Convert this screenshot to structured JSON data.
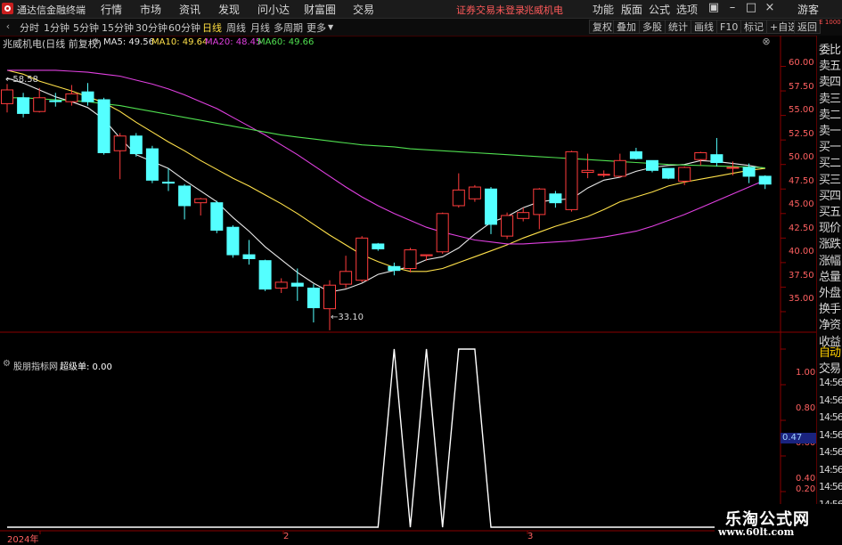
{
  "app": {
    "title": "通达信金融终端",
    "menu": [
      "行情",
      "市场",
      "资讯",
      "发现",
      "问小达",
      "财富圈",
      "交易"
    ],
    "warning": "证券交易未登录",
    "stock_name": "兆威机电",
    "right_menu": [
      "功能",
      "版面",
      "公式",
      "选项"
    ],
    "guest": "游客"
  },
  "toolbar": {
    "periods": [
      "分时",
      "1分钟",
      "5分钟",
      "15分钟",
      "30分钟",
      "60分钟",
      "日线",
      "周线",
      "月线",
      "多周期",
      "更多"
    ],
    "active_period": "日线",
    "buttons": [
      "复权",
      "叠加",
      "多股",
      "统计",
      "画线",
      "F10",
      "标记",
      "+自选",
      "返回"
    ]
  },
  "main_chart": {
    "header": "兆威机电(日线 前复权)",
    "ma": [
      {
        "label": "MA5: 49.56",
        "color": "#e8e8e8"
      },
      {
        "label": "MA10: 49.64",
        "color": "#ffe14a"
      },
      {
        "label": "MA20: 48.45",
        "color": "#e040e0"
      },
      {
        "label": "MA60: 49.66",
        "color": "#50e050"
      }
    ],
    "high_label": "58.58",
    "low_label": "33.10",
    "y_ticks": [
      "60.00",
      "57.50",
      "55.00",
      "52.50",
      "50.00",
      "47.50",
      "45.00",
      "42.50",
      "40.00",
      "37.50",
      "35.00"
    ]
  },
  "sub_chart": {
    "name": "股朋指标网",
    "series_label": "超级单: 0.00",
    "y_ticks": [
      "1.00",
      "0.80",
      "0.60",
      "0.40",
      "0.20"
    ],
    "cursor_value": "0.47"
  },
  "dates": [
    "2024年",
    "2",
    "3"
  ],
  "right_panel": {
    "header": "E 1000",
    "items": [
      "委比",
      "卖五",
      "卖四",
      "卖三",
      "卖二",
      "卖一",
      "买一",
      "买二",
      "买三",
      "买四",
      "买五",
      "现价",
      "涨跌",
      "涨幅",
      "总量",
      "外盘",
      "换手",
      "净资",
      "收益"
    ],
    "bottom_items": [
      "自动",
      "交易"
    ],
    "times": [
      "14:56",
      "14:56",
      "14:56",
      "14:56",
      "14:56",
      "14:56",
      "14:56",
      "14:56",
      "14:56"
    ]
  },
  "watermark": {
    "title": "乐淘公式网",
    "url": "www.60lt.com"
  },
  "chart_data": [
    {
      "type": "candlestick",
      "title": "兆威机电(日线 前复权)",
      "ylim": [
        33.0,
        61.5
      ],
      "up_color": "#ff3c3c",
      "down_color": "#54ffff",
      "candles": [
        [
          56.2,
          57.6,
          55.3,
          58.2
        ],
        [
          56.8,
          55.2,
          54.8,
          57.3
        ],
        [
          55.4,
          56.8,
          55.3,
          57.8
        ],
        [
          56.5,
          56.4,
          55.9,
          57.3
        ],
        [
          56.4,
          57.2,
          56.0,
          58.1
        ],
        [
          57.4,
          56.4,
          56.0,
          58.3
        ],
        [
          56.6,
          51.2,
          51.0,
          56.8
        ],
        [
          51.4,
          52.9,
          48.5,
          53.2
        ],
        [
          52.9,
          51.1,
          50.8,
          53.2
        ],
        [
          51.6,
          48.4,
          48.1,
          51.9
        ],
        [
          48.2,
          48.1,
          47.3,
          49.6
        ],
        [
          47.8,
          45.8,
          44.4,
          48.0
        ],
        [
          46.1,
          46.5,
          44.8,
          46.6
        ],
        [
          46.1,
          43.3,
          43.0,
          46.3
        ],
        [
          43.6,
          40.8,
          40.5,
          43.8
        ],
        [
          40.8,
          40.4,
          39.8,
          42.3
        ],
        [
          40.2,
          37.3,
          37.1,
          40.3
        ],
        [
          37.4,
          38.0,
          36.9,
          38.4
        ],
        [
          37.9,
          37.6,
          36.1,
          39.4
        ],
        [
          37.4,
          35.4,
          33.9,
          37.8
        ],
        [
          35.3,
          37.7,
          33.1,
          38.2
        ],
        [
          37.8,
          39.1,
          37.4,
          40.7
        ],
        [
          38.2,
          42.5,
          38.0,
          42.7
        ],
        [
          41.9,
          41.4,
          41.2,
          42.0
        ],
        [
          39.6,
          39.2,
          38.7,
          40.0
        ],
        [
          39.4,
          41.3,
          39.0,
          41.5
        ],
        [
          40.7,
          40.8,
          40.2,
          40.8
        ],
        [
          41.1,
          45.0,
          40.9,
          45.1
        ],
        [
          45.8,
          47.4,
          45.6,
          49.1
        ],
        [
          46.5,
          47.7,
          46.2,
          47.9
        ],
        [
          47.5,
          43.9,
          42.9,
          47.7
        ],
        [
          42.7,
          44.8,
          42.4,
          45.1
        ],
        [
          44.5,
          45.1,
          44.2,
          45.6
        ],
        [
          44.9,
          47.5,
          43.4,
          47.6
        ],
        [
          47.0,
          46.1,
          45.6,
          47.3
        ],
        [
          45.4,
          51.3,
          45.2,
          51.4
        ],
        [
          49.2,
          49.4,
          48.6,
          51.1
        ],
        [
          49.0,
          49.0,
          48.7,
          49.4
        ],
        [
          48.8,
          50.4,
          48.7,
          51.1
        ],
        [
          51.3,
          50.6,
          50.5,
          51.7
        ],
        [
          50.4,
          49.4,
          49.2,
          50.4
        ],
        [
          49.6,
          48.6,
          48.5,
          49.6
        ],
        [
          48.3,
          49.7,
          47.9,
          49.8
        ],
        [
          50.5,
          51.2,
          49.9,
          51.3
        ],
        [
          51.0,
          50.2,
          49.8,
          52.7
        ],
        [
          49.7,
          49.7,
          48.9,
          50.3
        ],
        [
          49.7,
          48.8,
          48.1,
          50.1
        ],
        [
          48.8,
          48.0,
          47.5,
          48.9
        ]
      ],
      "series": [
        {
          "name": "MA5",
          "color": "#e8e8e8",
          "values": [
            58.8,
            58.3,
            57.6,
            56.9,
            56.4,
            55.8,
            54.6,
            52.7,
            51.0,
            50.3,
            49.6,
            48.4,
            47.3,
            46.2,
            44.6,
            43.2,
            41.6,
            40.3,
            39.0,
            37.9,
            37.0,
            37.3,
            37.9,
            38.8,
            39.2,
            39.6,
            40.3,
            40.6,
            41.5,
            42.9,
            44.1,
            44.7,
            45.6,
            46.2,
            46.4,
            46.5,
            47.6,
            48.4,
            48.7,
            49.3,
            49.7,
            49.9,
            50.0,
            50.4,
            50.3,
            50.1,
            49.9,
            49.6
          ]
        },
        {
          "name": "MA10",
          "color": "#ffe14a",
          "values": [
            59.6,
            59.2,
            58.5,
            58.0,
            57.5,
            56.9,
            56.3,
            55.4,
            54.3,
            53.3,
            52.3,
            51.4,
            50.4,
            49.5,
            48.6,
            47.8,
            46.9,
            46.0,
            45.0,
            43.9,
            42.8,
            41.8,
            40.8,
            40.1,
            39.5,
            39.1,
            39.1,
            39.4,
            40.0,
            40.6,
            41.2,
            41.8,
            42.5,
            43.1,
            43.7,
            44.2,
            44.7,
            45.4,
            46.2,
            46.7,
            47.2,
            47.8,
            48.2,
            48.5,
            48.8,
            49.1,
            49.4,
            49.6
          ]
        },
        {
          "name": "MA20",
          "color": "#e040e0",
          "values": [
            59.6,
            59.6,
            59.6,
            59.6,
            59.5,
            59.4,
            59.2,
            59.0,
            58.6,
            58.2,
            57.7,
            57.1,
            56.4,
            55.7,
            54.8,
            53.9,
            53.0,
            52.0,
            51.0,
            49.9,
            48.8,
            47.7,
            46.7,
            45.8,
            45.0,
            44.3,
            43.6,
            43.1,
            42.7,
            42.3,
            42.1,
            41.9,
            41.9,
            42.0,
            42.1,
            42.2,
            42.4,
            42.6,
            42.9,
            43.2,
            43.7,
            44.3,
            44.9,
            45.6,
            46.3,
            47.0,
            47.7,
            48.4
          ]
        },
        {
          "name": "MA60",
          "color": "#50e050",
          "values": [
            56.8,
            56.8,
            56.7,
            56.6,
            56.5,
            56.4,
            56.2,
            56.0,
            55.7,
            55.4,
            55.1,
            54.8,
            54.5,
            54.2,
            53.9,
            53.6,
            53.3,
            53.0,
            52.8,
            52.6,
            52.4,
            52.2,
            52.0,
            51.9,
            51.8,
            51.6,
            51.5,
            51.4,
            51.3,
            51.2,
            51.1,
            51.0,
            50.9,
            50.8,
            50.7,
            50.6,
            50.5,
            50.4,
            50.3,
            50.2,
            50.1,
            50.0,
            49.95,
            49.9,
            49.85,
            49.8,
            49.75,
            49.66
          ]
        }
      ]
    },
    {
      "type": "line",
      "title": "股朋指标网",
      "ylim": [
        0,
        1.0
      ],
      "series": [
        {
          "name": "超级单",
          "color": "#ffffff",
          "values": [
            0,
            0,
            0,
            0,
            0,
            0,
            0,
            0,
            0,
            0,
            0,
            0,
            0,
            0,
            0,
            0,
            0,
            0,
            0,
            0,
            0,
            0,
            0,
            0,
            1,
            0,
            1,
            0,
            1,
            1,
            0,
            0,
            0,
            0,
            0,
            0,
            0,
            0,
            0,
            0,
            0,
            0,
            0,
            0,
            0,
            0,
            0,
            0
          ]
        }
      ]
    }
  ]
}
